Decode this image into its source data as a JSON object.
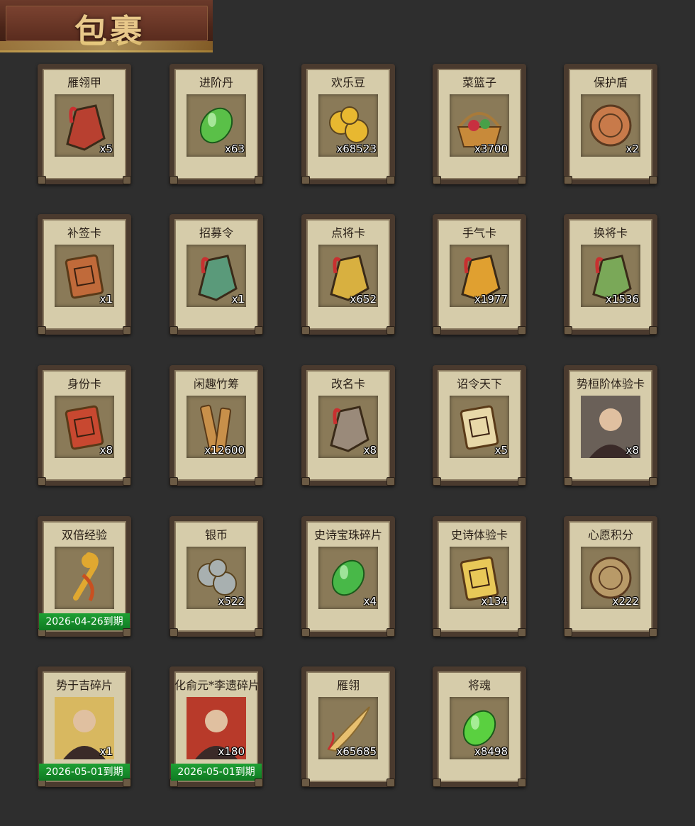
{
  "header": {
    "title": "包裹"
  },
  "items": [
    {
      "name": "雁翎甲",
      "qty": "x5",
      "icon": "armor-icon",
      "color": "#b84030"
    },
    {
      "name": "进阶丹",
      "qty": "x63",
      "icon": "pill-icon",
      "color": "#5ac048"
    },
    {
      "name": "欢乐豆",
      "qty": "x68523",
      "icon": "beans-icon",
      "color": "#e8b830"
    },
    {
      "name": "菜篮子",
      "qty": "x3700",
      "icon": "basket-icon",
      "color": "#c88a3a"
    },
    {
      "name": "保护盾",
      "qty": "x2",
      "icon": "shield-icon",
      "color": "#c87a4a"
    },
    {
      "name": "补签卡",
      "qty": "x1",
      "icon": "tag-card-icon",
      "color": "#c06a3a"
    },
    {
      "name": "招募令",
      "qty": "x1",
      "icon": "recruit-token-icon",
      "color": "#5a9a7a"
    },
    {
      "name": "点将卡",
      "qty": "x652",
      "icon": "general-token-icon",
      "color": "#d8b040"
    },
    {
      "name": "手气卡",
      "qty": "x1977",
      "icon": "luck-card-icon",
      "color": "#e0a030"
    },
    {
      "name": "换将卡",
      "qty": "x1536",
      "icon": "swap-token-icon",
      "color": "#7aa858"
    },
    {
      "name": "身份卡",
      "qty": "x8",
      "icon": "identity-mask-icon",
      "color": "#c84830"
    },
    {
      "name": "闲趣竹筹",
      "qty": "x12600",
      "icon": "bamboo-slips-icon",
      "color": "#c8904a"
    },
    {
      "name": "改名卡",
      "qty": "x8",
      "icon": "rename-token-icon",
      "color": "#9a8a7a"
    },
    {
      "name": "诏令天下",
      "qty": "x5",
      "icon": "scroll-icon",
      "color": "#e8d8a8"
    },
    {
      "name": "势桓阶体验卡",
      "qty": "x8",
      "icon": "general-portrait-icon",
      "color": "#6a6058"
    },
    {
      "name": "双倍经验",
      "qty": "",
      "icon": "ruyi-icon",
      "color": "#e0a830",
      "expiry": "2026-04-26到期"
    },
    {
      "name": "银币",
      "qty": "x522",
      "icon": "silver-coins-icon",
      "color": "#a8b0b0"
    },
    {
      "name": "史诗宝珠碎片",
      "qty": "x4",
      "icon": "jade-shard-icon",
      "color": "#48b848"
    },
    {
      "name": "史诗体验卡",
      "qty": "x134",
      "icon": "gold-card-icon",
      "color": "#e8c858"
    },
    {
      "name": "心愿积分",
      "qty": "x222",
      "icon": "heart-coin-icon",
      "color": "#b89a68"
    },
    {
      "name": "势于吉碎片",
      "qty": "x1",
      "icon": "puzzle-portrait-icon",
      "color": "#d8b860",
      "expiry": "2026-05-01到期"
    },
    {
      "name": "化俞元*李遗碎片",
      "qty": "x180",
      "icon": "hero-portrait-icon",
      "color": "#b83a2a",
      "expiry": "2026-05-01到期"
    },
    {
      "name": "雁翎",
      "qty": "x65685",
      "icon": "feather-icon",
      "color": "#e8c070"
    },
    {
      "name": "将魂",
      "qty": "x8498",
      "icon": "soul-crystal-icon",
      "color": "#5ad040"
    }
  ]
}
